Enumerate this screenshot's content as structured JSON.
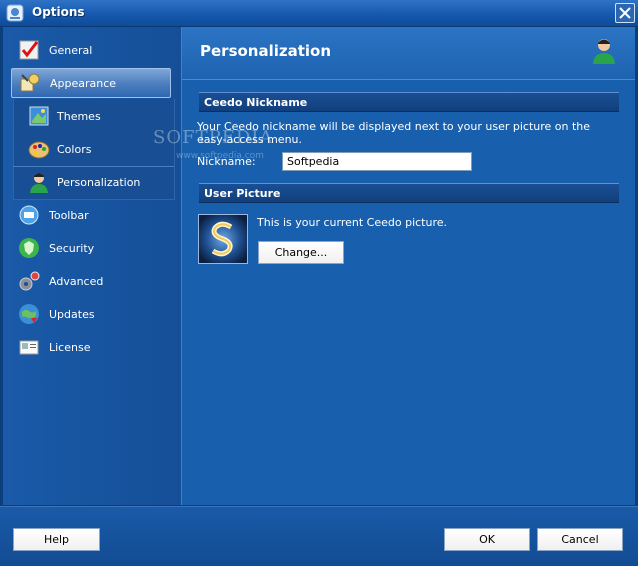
{
  "window": {
    "title": "Options",
    "close_icon": "close-icon"
  },
  "sidebar": {
    "items": [
      {
        "label": "General",
        "icon": "general-icon"
      },
      {
        "label": "Appearance",
        "icon": "appearance-icon",
        "selected": true
      },
      {
        "label": "Themes",
        "icon": "themes-icon",
        "sub": true
      },
      {
        "label": "Colors",
        "icon": "colors-icon",
        "sub": true
      },
      {
        "label": "Personalization",
        "icon": "user-icon",
        "sub": true
      },
      {
        "label": "Toolbar",
        "icon": "toolbar-icon"
      },
      {
        "label": "Security",
        "icon": "security-icon"
      },
      {
        "label": "Advanced",
        "icon": "advanced-icon"
      },
      {
        "label": "Updates",
        "icon": "updates-icon"
      },
      {
        "label": "License",
        "icon": "license-icon"
      }
    ]
  },
  "main": {
    "title": "Personalization",
    "nickname_section": {
      "header": "Ceedo Nickname",
      "description": "Your Ceedo nickname will be displayed next to your user picture on the easy-access menu.",
      "label": "Nickname:",
      "value": "Softpedia"
    },
    "picture_section": {
      "header": "User Picture",
      "text": "This is your current Ceedo picture.",
      "change_label": "Change..."
    }
  },
  "footer": {
    "help_label": "Help",
    "ok_label": "OK",
    "cancel_label": "Cancel"
  },
  "watermark": {
    "main": "SOFTPEDIA",
    "sub": "www.softpedia.com"
  }
}
